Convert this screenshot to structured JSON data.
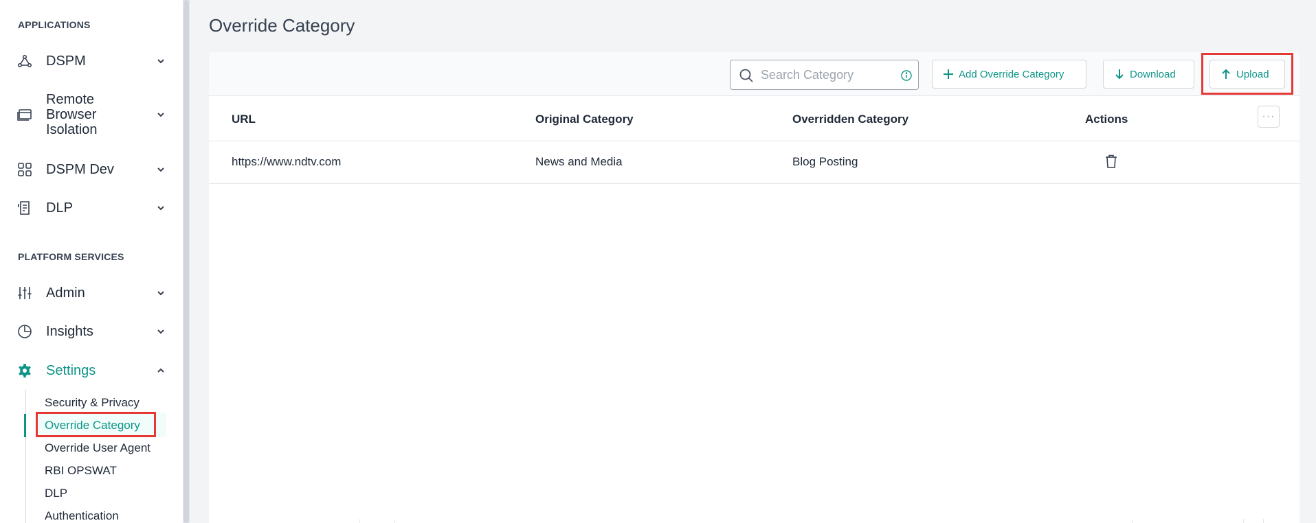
{
  "sidebar": {
    "applications_title": "APPLICATIONS",
    "platform_title": "PLATFORM SERVICES",
    "items": [
      {
        "label": "DSPM",
        "icon": "network-icon"
      },
      {
        "label": "Remote Browser Isolation",
        "line1": "Remote",
        "line2": "Browser",
        "line3": "Isolation",
        "icon": "browser-window-icon"
      },
      {
        "label": "DSPM Dev",
        "icon": "grid-icon"
      },
      {
        "label": "DLP",
        "icon": "document-icon"
      },
      {
        "label": "Admin",
        "icon": "sliders-icon"
      },
      {
        "label": "Insights",
        "icon": "pie-chart-icon"
      },
      {
        "label": "Settings",
        "icon": "gear-icon"
      }
    ],
    "settings_sub": [
      "Security & Privacy",
      "Override Category",
      "Override User Agent",
      "RBI OPSWAT",
      "DLP",
      "Authentication"
    ],
    "active_sub": "Override Category"
  },
  "page": {
    "title": "Override Category"
  },
  "toolbar": {
    "search_placeholder": "Search Category",
    "search_value": "",
    "add_label": "Add Override Category",
    "download_label": "Download",
    "upload_label": "Upload"
  },
  "table": {
    "headers": [
      "URL",
      "Original Category",
      "Overridden Category",
      "Actions"
    ],
    "rows": [
      {
        "url": "https://www.ndtv.com",
        "original": "News and Media",
        "overridden": "Blog Posting"
      }
    ],
    "more_label": "···"
  },
  "colors": {
    "accent": "#0d9488",
    "highlight": "#e53935"
  }
}
